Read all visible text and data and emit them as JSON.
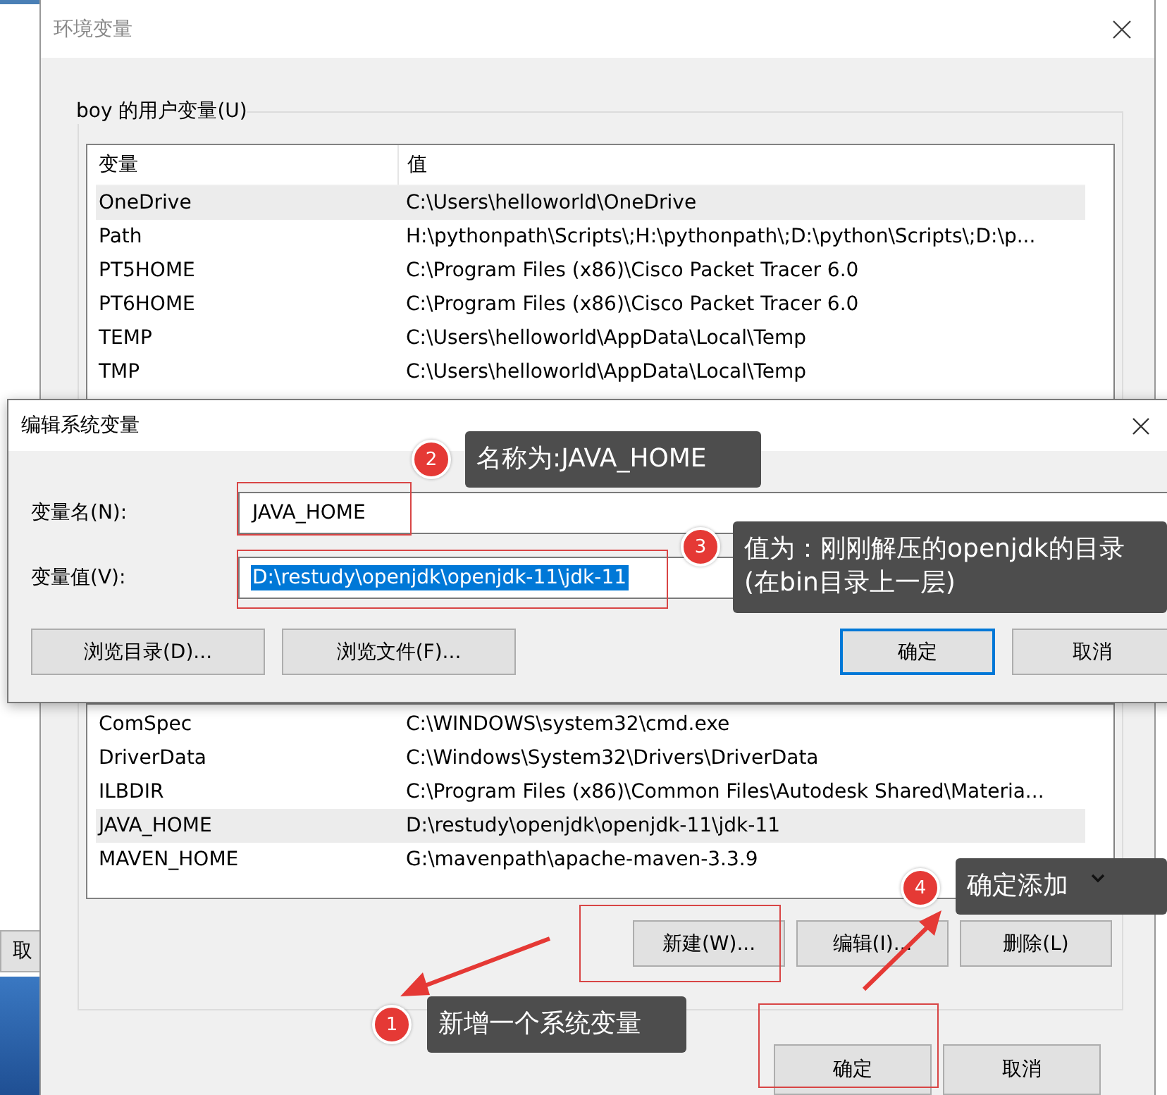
{
  "background_window": {
    "button": "取"
  },
  "main_dialog": {
    "title": "环境变量",
    "user_vars": {
      "label": "boy 的用户变量(U)",
      "columns": [
        "变量",
        "值"
      ],
      "rows": [
        {
          "name": "OneDrive",
          "value": "C:\\Users\\helloworld\\OneDrive",
          "selected": true
        },
        {
          "name": "Path",
          "value": "H:\\pythonpath\\Scripts\\;H:\\pythonpath\\;D:\\python\\Scripts\\;D:\\p...",
          "selected": false
        },
        {
          "name": "PT5HOME",
          "value": "C:\\Program Files (x86)\\Cisco Packet Tracer 6.0",
          "selected": false
        },
        {
          "name": "PT6HOME",
          "value": "C:\\Program Files (x86)\\Cisco Packet Tracer 6.0",
          "selected": false
        },
        {
          "name": "TEMP",
          "value": "C:\\Users\\helloworld\\AppData\\Local\\Temp",
          "selected": false
        },
        {
          "name": "TMP",
          "value": "C:\\Users\\helloworld\\AppData\\Local\\Temp",
          "selected": false
        }
      ]
    },
    "system_vars": {
      "rows": [
        {
          "name": "ComSpec",
          "value": "C:\\WINDOWS\\system32\\cmd.exe",
          "selected": false
        },
        {
          "name": "DriverData",
          "value": "C:\\Windows\\System32\\Drivers\\DriverData",
          "selected": false
        },
        {
          "name": "ILBDIR",
          "value": "C:\\Program Files (x86)\\Common Files\\Autodesk Shared\\Materia...",
          "selected": false
        },
        {
          "name": "JAVA_HOME",
          "value": "D:\\restudy\\openjdk\\openjdk-11\\jdk-11",
          "selected": true
        },
        {
          "name": "MAVEN_HOME",
          "value": "G:\\mavenpath\\apache-maven-3.3.9",
          "selected": false
        }
      ],
      "buttons": [
        "新建(W)...",
        "编辑(I)...",
        "删除(L)"
      ]
    },
    "buttons": [
      "确定",
      "取消"
    ]
  },
  "edit_dialog": {
    "title": "编辑系统变量",
    "fields": [
      {
        "label": "变量名(N):",
        "value": "JAVA_HOME",
        "text_selected": false
      },
      {
        "label": "变量值(V):",
        "value": "D:\\restudy\\openjdk\\openjdk-11\\jdk-11",
        "text_selected": true
      }
    ],
    "buttons": [
      {
        "label": "浏览目录(D)...",
        "default": false
      },
      {
        "label": "浏览文件(F)...",
        "default": false
      },
      {
        "label": "确定",
        "default": true
      },
      {
        "label": "取消",
        "default": false
      }
    ]
  },
  "annotations": [
    {
      "number": "2",
      "text": "名称为:JAVA_HOME"
    },
    {
      "number": "3",
      "text": "值为：刚刚解压的openjdk的目录(在bin目录上一层)"
    },
    {
      "number": "4",
      "text": "确定添加"
    },
    {
      "number": "1",
      "text": "新增一个系统变量"
    }
  ]
}
